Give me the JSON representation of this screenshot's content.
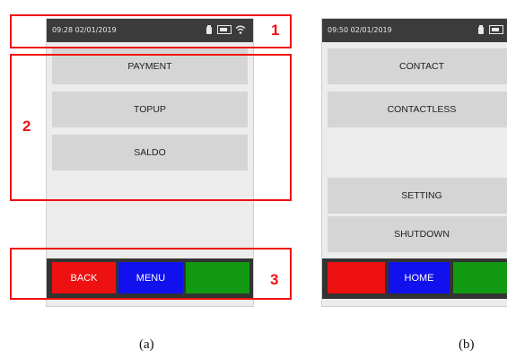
{
  "screen_a": {
    "status_time": "09:28 02/01/2019",
    "menu_items": [
      {
        "label": "PAYMENT"
      },
      {
        "label": "TOPUP"
      },
      {
        "label": "SALDO"
      }
    ],
    "bottom_buttons": [
      {
        "label": "BACK",
        "color": "#ee1111"
      },
      {
        "label": "MENU",
        "color": "#1111ee"
      },
      {
        "label": "",
        "color": "#119911"
      }
    ],
    "caption": "(a)"
  },
  "screen_b": {
    "status_time": "09:50 02/01/2019",
    "menu_items": [
      {
        "label": "CONTACT"
      },
      {
        "label": "CONTACTLESS"
      },
      {
        "label": "SETTING"
      },
      {
        "label": "SHUTDOWN"
      }
    ],
    "bottom_buttons": [
      {
        "label": "",
        "color": "#ee1111"
      },
      {
        "label": "HOME",
        "color": "#1111ee"
      },
      {
        "label": "",
        "color": "#119911"
      }
    ],
    "caption": "(b)"
  },
  "annotations": [
    {
      "label": "1"
    },
    {
      "label": "2"
    },
    {
      "label": "3"
    }
  ],
  "status_icons": [
    "battery-icon",
    "sim-card-icon",
    "wifi-icon"
  ],
  "colors": {
    "highlight": "#ee1111",
    "status_bar": "#3b3b3b",
    "button_bg": "#d5d5d5",
    "screen_bg": "#ececec"
  }
}
